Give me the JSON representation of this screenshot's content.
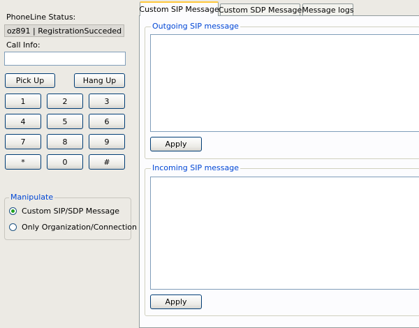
{
  "phone": {
    "status_label": "PhoneLine Status:",
    "status_value": "oz891 | RegistrationSucceded",
    "callinfo_label": "Call Info:",
    "callinfo_value": "",
    "pickup_label": "Pick Up",
    "hangup_label": "Hang Up",
    "keys": [
      "1",
      "2",
      "3",
      "4",
      "5",
      "6",
      "7",
      "8",
      "9",
      "*",
      "0",
      "#"
    ]
  },
  "manipulate": {
    "title": "Manipulate",
    "options": [
      "Custom SIP/SDP Message",
      "Only Organization/Connection"
    ],
    "selected": "Custom SIP/SDP Message"
  },
  "tabs": [
    "Custom SIP Message",
    "Custom SDP Message",
    "Message logs"
  ],
  "active_tab": "Custom SIP Message",
  "outgoing": {
    "title": "Outgoing SIP message",
    "value": "",
    "apply_label": "Apply"
  },
  "incoming": {
    "title": "Incoming SIP message",
    "value": "",
    "apply_label": "Apply"
  },
  "colors": {
    "background": "#eceae4",
    "group_title": "#0046d5",
    "active_tab_accent": "#ffc83c",
    "radio_selected": "#21a121",
    "button_border": "#003c74"
  }
}
